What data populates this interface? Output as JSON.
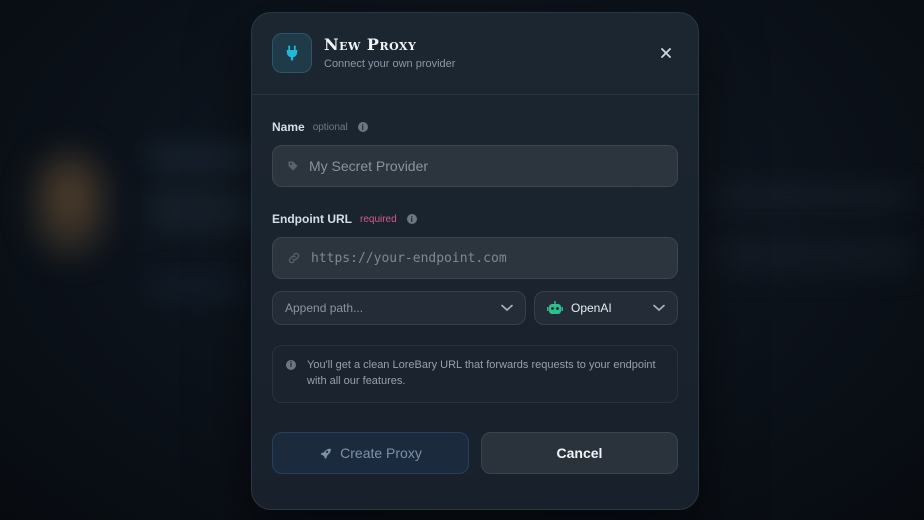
{
  "modal": {
    "title": "New Proxy",
    "subtitle": "Connect your own provider",
    "header_icon": "plug-icon",
    "close_icon": "close-icon"
  },
  "name_field": {
    "label": "Name",
    "tag": "optional",
    "placeholder": "My Secret Provider",
    "icon": "tag-icon"
  },
  "endpoint_field": {
    "label": "Endpoint URL",
    "tag": "required",
    "placeholder": "https://your-endpoint.com",
    "icon": "link-icon"
  },
  "append_path": {
    "placeholder": "Append path..."
  },
  "provider_select": {
    "value": "OpenAI",
    "icon": "robot-icon"
  },
  "notice": {
    "text": "You'll get a clean LoreBary URL that forwards requests to your endpoint with all our features."
  },
  "buttons": {
    "create": "Create Proxy",
    "cancel": "Cancel"
  },
  "colors": {
    "accent": "#22b8d6",
    "required": "#d25c8a",
    "robot": "#2fbf8f"
  }
}
